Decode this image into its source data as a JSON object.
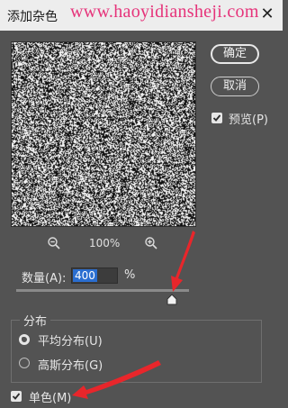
{
  "title_bar": {
    "title": "添加杂色",
    "watermark": "www.haoyidiansheji.com",
    "close_label": "✕"
  },
  "preview": {
    "zoom_level": "100%"
  },
  "buttons": {
    "ok": "确定",
    "cancel": "取消"
  },
  "options": {
    "preview_label": "预览(P)",
    "preview_checked": true,
    "monochrome_label": "单色(M)",
    "monochrome_checked": true
  },
  "amount": {
    "label": "数量(A):",
    "value": "400",
    "unit": "%",
    "level_fraction": 0.93
  },
  "distribution": {
    "title": "分布",
    "uniform_label": "平均分布(U)",
    "gaussian_label": "高斯分布(G)",
    "selected": "uniform"
  },
  "colors": {
    "accent": "#2a6ed0",
    "arrow": "#e8262b",
    "dialog_bg": "#535353"
  }
}
